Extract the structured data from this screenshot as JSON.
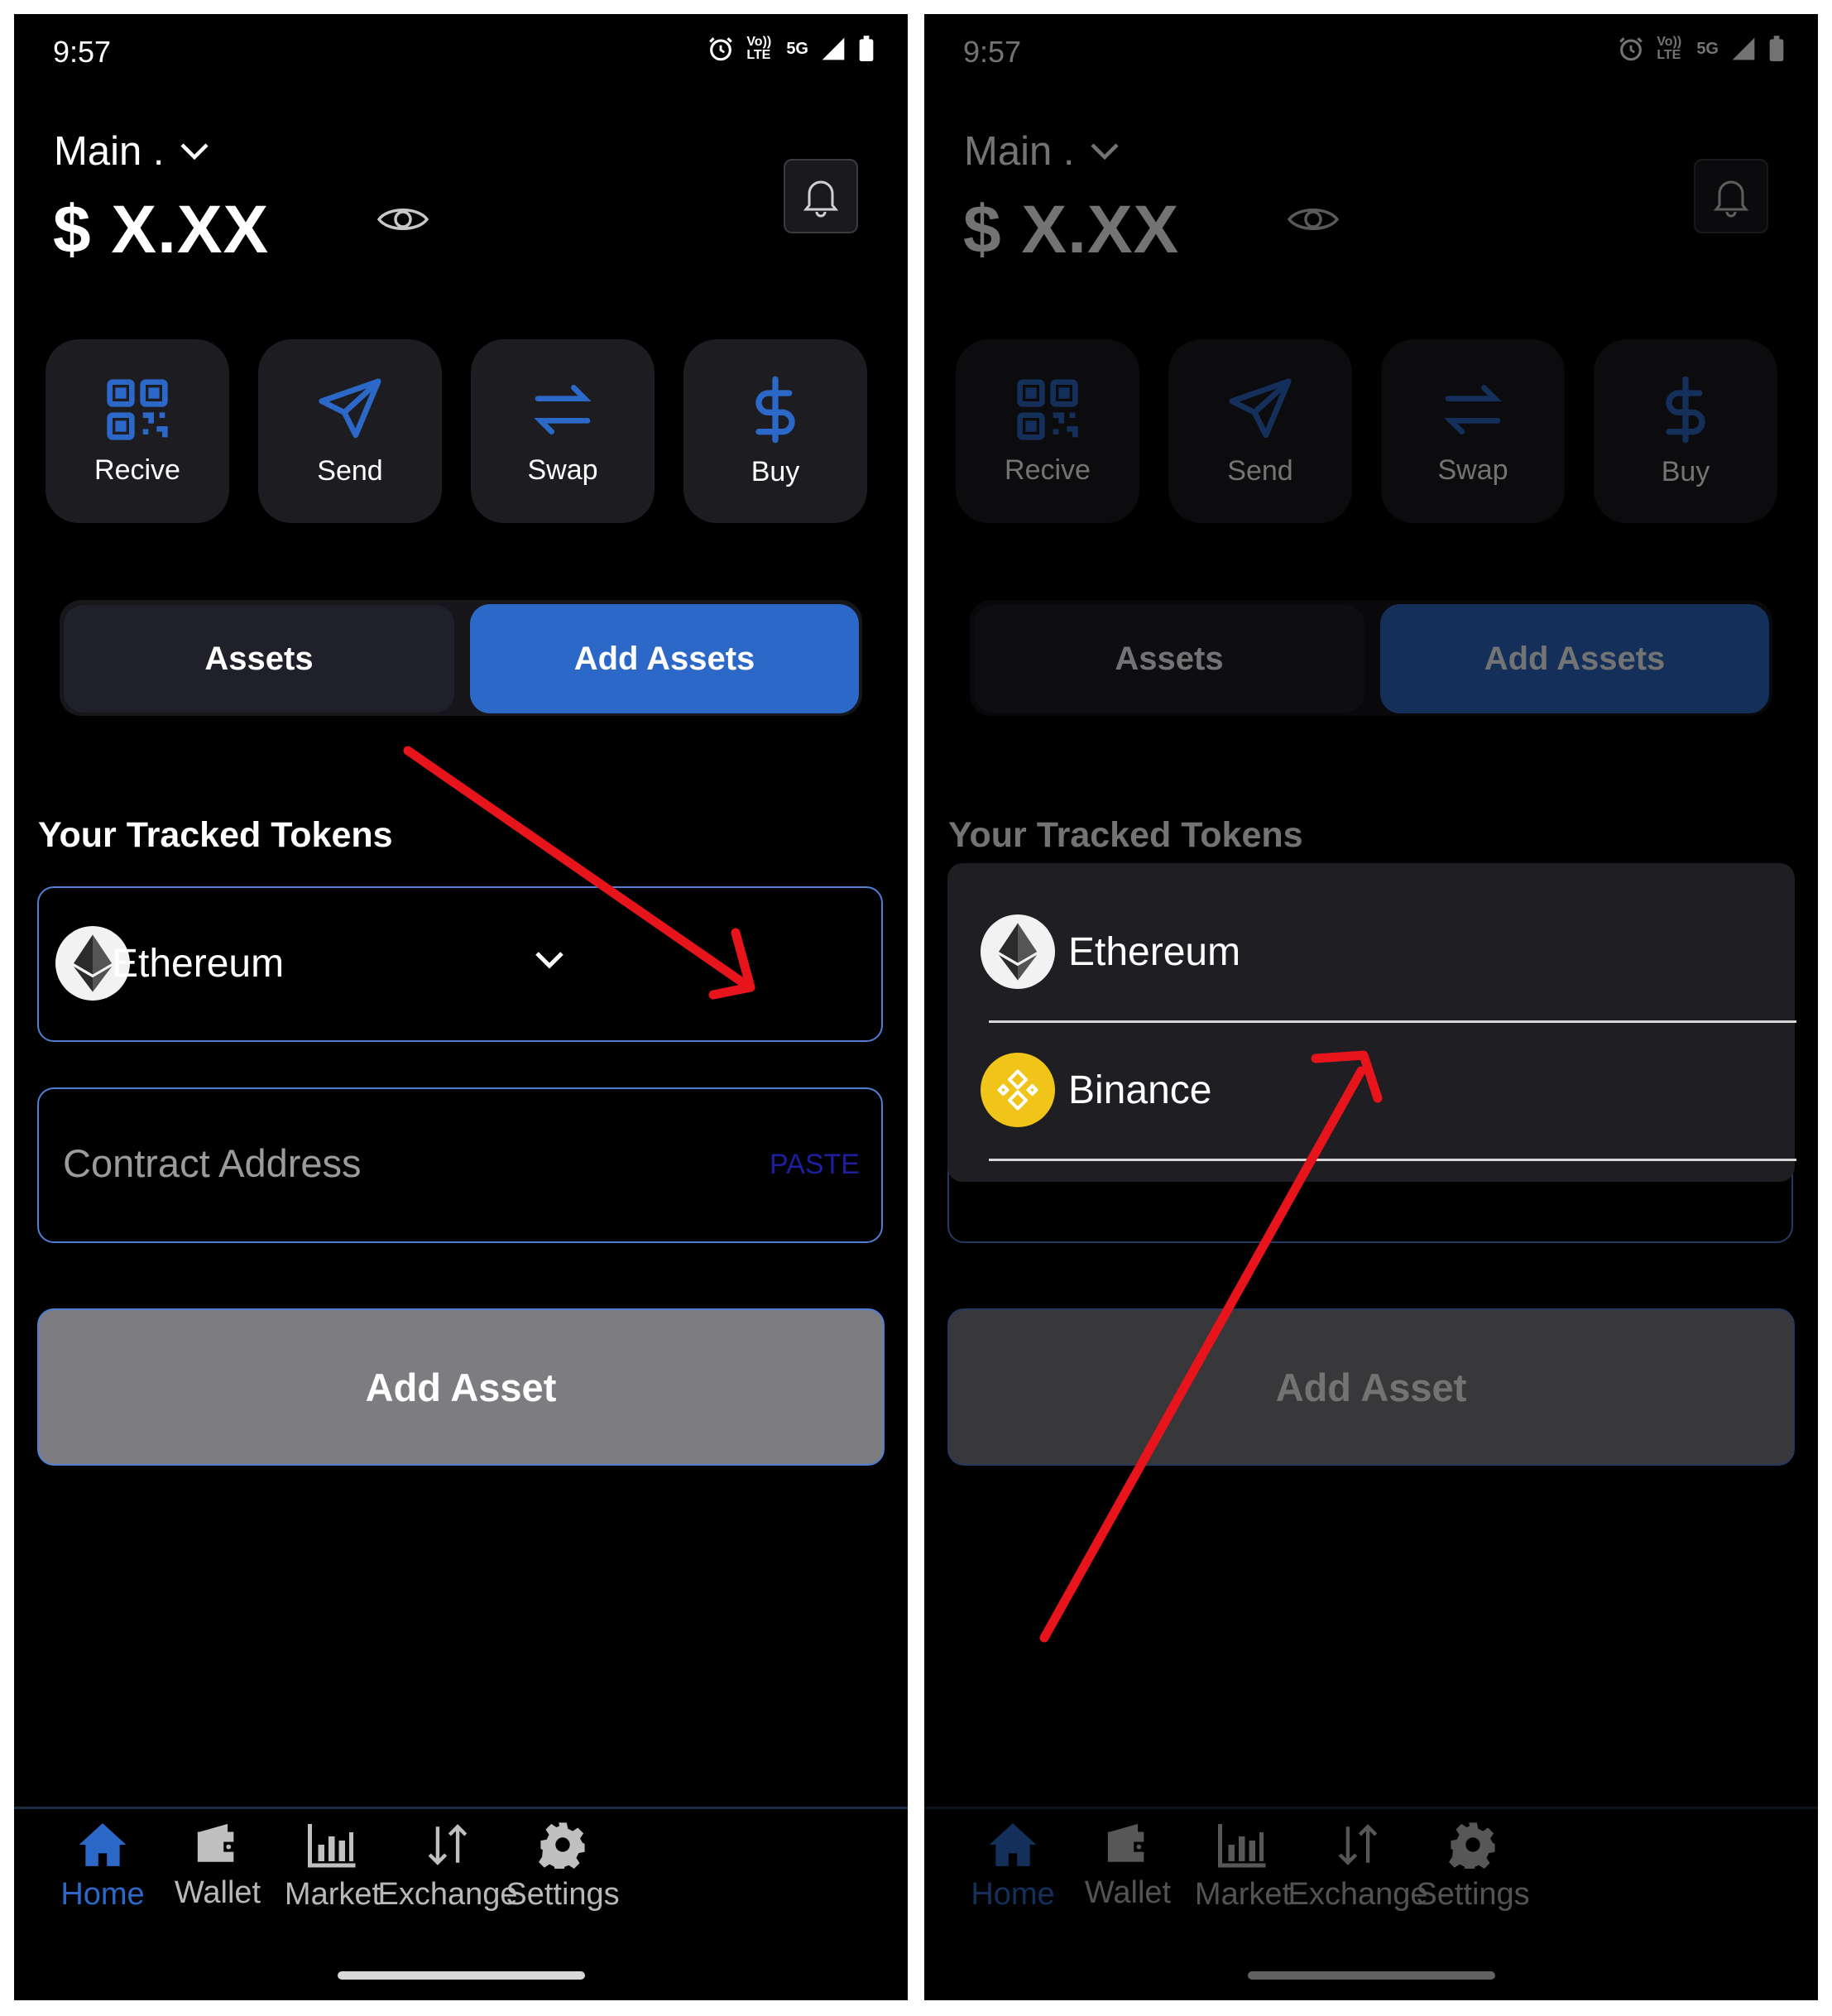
{
  "status": {
    "time": "9:57",
    "volte": "Vo)) LTE",
    "network": "5G"
  },
  "account": {
    "name": "Main .",
    "balance": "$ X.XX"
  },
  "actions": [
    {
      "label": "Recive",
      "icon": "qr-code-icon"
    },
    {
      "label": "Send",
      "icon": "send-icon"
    },
    {
      "label": "Swap",
      "icon": "swap-icon"
    },
    {
      "label": "Buy",
      "icon": "dollar-icon"
    }
  ],
  "tabs": {
    "assets": "Assets",
    "add_assets": "Add Assets"
  },
  "section_title": "Your Tracked Tokens",
  "token_select": {
    "selected": "Ethereum",
    "options": [
      "Ethereum",
      "Binance"
    ]
  },
  "contract": {
    "placeholder": "Contract Address",
    "paste": "PASTE"
  },
  "add_button": "Add Asset",
  "nav": [
    {
      "label": "Home",
      "icon": "home-icon",
      "active": true
    },
    {
      "label": "Wallet",
      "icon": "wallet-icon",
      "active": false
    },
    {
      "label": "Market",
      "icon": "market-chart-icon",
      "active": false
    },
    {
      "label": "Exchange",
      "icon": "exchange-arrows-icon",
      "active": false
    },
    {
      "label": "Settings",
      "icon": "gear-icon",
      "active": false
    }
  ],
  "colors": {
    "accent": "#2c68c8",
    "annotation_arrow": "#e8141b",
    "binance": "#f0c419"
  }
}
